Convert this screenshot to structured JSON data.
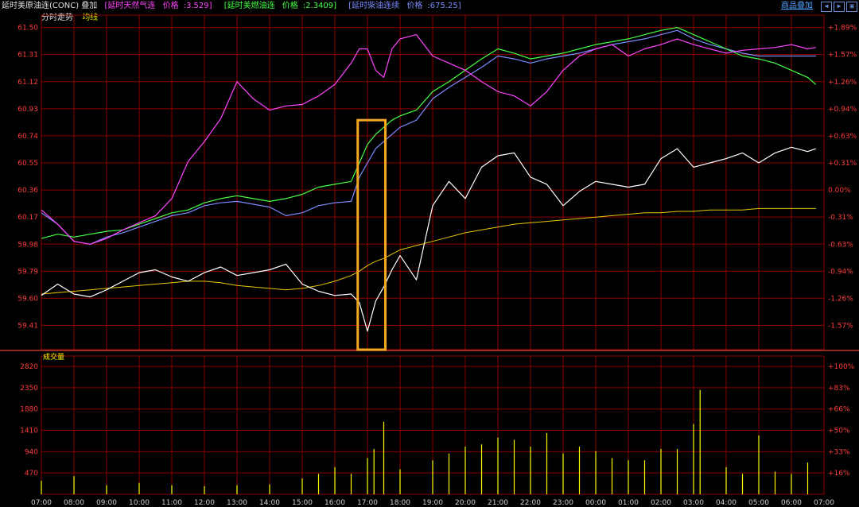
{
  "header": {
    "main_title": "延时美原油连(CONC) 叠加",
    "overlays": [
      {
        "name": "[延时天然气连",
        "price_label": "价格",
        "price": "3.529]",
        "color": "#ff44ff"
      },
      {
        "name": "[延时美燃油连",
        "price_label": "价格",
        "price": "2.3409]",
        "color": "#44ff44"
      },
      {
        "name": "[延时柴油连续",
        "price_label": "价格",
        "price": "675.25]",
        "color": "#7b8cff"
      }
    ],
    "overlay_button": "商品叠加",
    "window_buttons": [
      "◀",
      "▶",
      "▣"
    ]
  },
  "subheader": {
    "mode": "分时走势",
    "avg": "均线"
  },
  "colors": {
    "main_line": "#ffffff",
    "avg_line": "#e6c800",
    "nat_gas": "#ff44ff",
    "heating_oil": "#44ff44",
    "diesel": "#7b8cff",
    "volume": "#ffff00",
    "grid": "#8b0000",
    "left_labels": "#ff3b3b",
    "highlight_box": "#f5a623"
  },
  "chart_data": [
    {
      "type": "line",
      "title": "",
      "ylim": [
        59.24,
        61.52
      ],
      "y_ticks": [
        "61.50",
        "61.31",
        "61.12",
        "60.93",
        "60.74",
        "60.55",
        "60.36",
        "60.17",
        "59.98",
        "59.79",
        "59.60",
        "59.41"
      ],
      "y_pct_ticks": [
        "+1.89%",
        "+1.57%",
        "+1.26%",
        "+0.94%",
        "+0.63%",
        "+0.31%",
        "0.00%",
        "-0.31%",
        "-0.63%",
        "-0.94%",
        "-1.26%",
        "-1.57%"
      ],
      "x_ticks": [
        "07:00",
        "08:00",
        "09:00",
        "10:00",
        "11:00",
        "12:00",
        "13:00",
        "14:00",
        "15:00",
        "16:00",
        "17:00",
        "18:00",
        "19:00",
        "20:00",
        "21:00",
        "22:00",
        "23:00",
        "00:00",
        "01:00",
        "02:00",
        "03:00",
        "04:00",
        "05:00",
        "06:00",
        "07:00"
      ],
      "x": [
        0,
        0.5,
        1,
        1.5,
        2,
        2.5,
        3,
        3.5,
        4,
        4.5,
        5,
        5.5,
        6,
        6.5,
        7,
        7.5,
        8,
        8.5,
        9,
        9.5,
        9.75,
        10,
        10.25,
        10.5,
        10.75,
        11,
        11.5,
        12,
        12.5,
        13,
        13.5,
        14,
        14.5,
        15,
        15.5,
        16,
        16.5,
        17,
        17.5,
        18,
        18.5,
        19,
        19.5,
        20,
        20.5,
        21,
        21.5,
        22,
        22.5,
        23,
        23.5,
        23.75
      ],
      "series": [
        {
          "key": "main",
          "values": [
            59.62,
            59.7,
            59.63,
            59.61,
            59.66,
            59.72,
            59.78,
            59.8,
            59.75,
            59.72,
            59.78,
            59.82,
            59.76,
            59.78,
            59.8,
            59.84,
            59.7,
            59.65,
            59.62,
            59.63,
            59.57,
            59.37,
            59.58,
            59.68,
            59.8,
            59.9,
            59.73,
            60.25,
            60.42,
            60.3,
            60.52,
            60.6,
            60.62,
            60.45,
            60.4,
            60.25,
            60.35,
            60.42,
            60.4,
            60.38,
            60.4,
            60.58,
            60.65,
            60.52,
            60.55,
            60.58,
            60.62,
            60.55,
            60.62,
            60.66,
            60.63,
            60.65
          ]
        },
        {
          "key": "avg",
          "values": [
            59.63,
            59.64,
            59.65,
            59.66,
            59.67,
            59.68,
            59.69,
            59.7,
            59.71,
            59.72,
            59.72,
            59.71,
            59.69,
            59.68,
            59.67,
            59.66,
            59.67,
            59.69,
            59.72,
            59.76,
            59.79,
            59.83,
            59.86,
            59.88,
            59.91,
            59.94,
            59.97,
            60.0,
            60.03,
            60.06,
            60.08,
            60.1,
            60.12,
            60.13,
            60.14,
            60.15,
            60.16,
            60.17,
            60.18,
            60.19,
            60.2,
            60.2,
            60.21,
            60.21,
            60.22,
            60.22,
            60.22,
            60.23,
            60.23,
            60.23,
            60.23,
            60.23
          ]
        },
        {
          "key": "nat_gas",
          "values": [
            60.22,
            60.12,
            60.0,
            59.98,
            60.02,
            60.08,
            60.13,
            60.18,
            60.3,
            60.56,
            60.7,
            60.86,
            61.12,
            61.0,
            60.92,
            60.95,
            60.96,
            61.02,
            61.1,
            61.25,
            61.35,
            61.35,
            61.2,
            61.15,
            61.35,
            61.42,
            61.45,
            61.3,
            61.25,
            61.2,
            61.12,
            61.05,
            61.02,
            60.95,
            61.05,
            61.2,
            61.3,
            61.35,
            61.38,
            61.3,
            61.35,
            61.38,
            61.42,
            61.38,
            61.35,
            61.32,
            61.34,
            61.35,
            61.36,
            61.38,
            61.35,
            61.36
          ]
        },
        {
          "key": "heating_oil",
          "values": [
            60.02,
            60.05,
            60.03,
            60.05,
            60.07,
            60.08,
            60.12,
            60.16,
            60.2,
            60.22,
            60.27,
            60.3,
            60.32,
            60.3,
            60.28,
            60.3,
            60.33,
            60.38,
            60.4,
            60.42,
            60.55,
            60.68,
            60.75,
            60.8,
            60.85,
            60.88,
            60.92,
            61.05,
            61.12,
            61.2,
            61.28,
            61.35,
            61.32,
            61.28,
            61.3,
            61.32,
            61.35,
            61.38,
            61.4,
            61.42,
            61.45,
            61.48,
            61.5,
            61.45,
            61.4,
            61.35,
            61.3,
            61.28,
            61.25,
            61.2,
            61.15,
            61.1
          ]
        },
        {
          "key": "diesel",
          "values": [
            60.2,
            60.12,
            60.0,
            59.98,
            60.03,
            60.06,
            60.1,
            60.14,
            60.18,
            60.2,
            60.25,
            60.27,
            60.28,
            60.26,
            60.24,
            60.18,
            60.2,
            60.25,
            60.27,
            60.28,
            60.45,
            60.55,
            60.65,
            60.7,
            60.75,
            60.8,
            60.85,
            61.0,
            61.08,
            61.15,
            61.22,
            61.3,
            61.28,
            61.25,
            61.28,
            61.3,
            61.32,
            61.35,
            61.38,
            61.4,
            61.42,
            61.45,
            61.48,
            61.42,
            61.38,
            61.35,
            61.32,
            61.3,
            61.3,
            61.3,
            61.3,
            61.3
          ]
        }
      ]
    },
    {
      "type": "bar",
      "title": "成交量",
      "ylim": [
        0,
        3050
      ],
      "y_ticks": [
        "2820",
        "2350",
        "1880",
        "1410",
        "940",
        "470"
      ],
      "y_pct_ticks": [
        "+100%",
        "+83%",
        "+66%",
        "+50%",
        "+33%",
        "+16%"
      ],
      "x": [
        0,
        1,
        2,
        3,
        4,
        5,
        6,
        7,
        8,
        8.5,
        9,
        9.5,
        10,
        10.2,
        10.5,
        11,
        12,
        12.5,
        13,
        13.5,
        14,
        14.5,
        15,
        15.5,
        16,
        16.5,
        17,
        17.5,
        18,
        18.5,
        19,
        19.5,
        20,
        20.2,
        21,
        21.5,
        22,
        22.5,
        23,
        23.5
      ],
      "values": [
        300,
        400,
        200,
        250,
        200,
        180,
        200,
        220,
        350,
        450,
        600,
        450,
        800,
        1000,
        1600,
        550,
        750,
        900,
        1050,
        1100,
        1250,
        1200,
        1050,
        1350,
        900,
        1050,
        950,
        800,
        750,
        750,
        1000,
        1000,
        1550,
        2300,
        600,
        450,
        1300,
        500,
        450,
        700
      ]
    }
  ]
}
